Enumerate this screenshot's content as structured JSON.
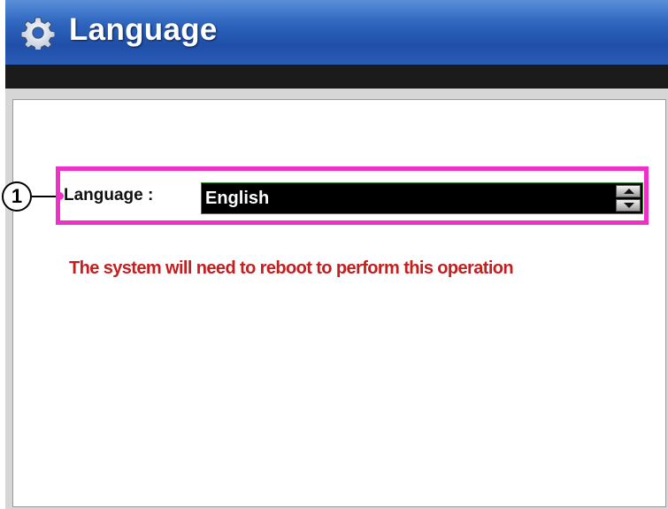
{
  "window": {
    "title": "Language",
    "title_icon": "gear-icon"
  },
  "form": {
    "language_label": "Language :",
    "language_value": "English",
    "spinner_icons": [
      "arrow-up-icon",
      "arrow-down-icon"
    ]
  },
  "notice": {
    "text": "The system will need to reboot to perform this operation",
    "color": "#c41e1e"
  },
  "annotation": {
    "callout_number": "1",
    "highlight_color": "#ee2fc8"
  },
  "colors": {
    "titlebar": "#2f66bf",
    "select_background": "#000000",
    "select_text": "#ffffff"
  }
}
